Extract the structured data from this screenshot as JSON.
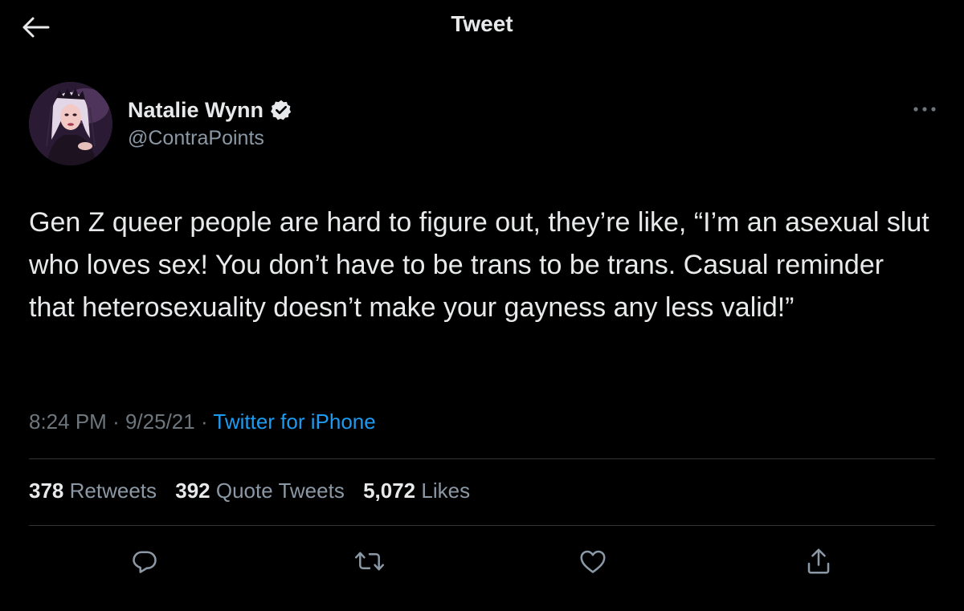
{
  "header": {
    "title": "Tweet",
    "back_icon": "arrow-left-icon"
  },
  "author": {
    "display_name": "Natalie Wynn",
    "handle": "@ContraPoints",
    "verified_icon": "verified-badge-icon",
    "more_icon": "more-horizontal-icon"
  },
  "tweet": {
    "text": "Gen Z queer people are hard to figure out, they’re like, “I’m an asexual slut who loves sex! You don’t have to be trans to be trans. Casual reminder that heterosexuality doesn’t make your gayness any less valid!”",
    "time": "8:24 PM",
    "date": "9/25/21",
    "separator": "·",
    "source": "Twitter for iPhone"
  },
  "stats": {
    "retweets_count": "378",
    "retweets_label": "Retweets",
    "quotes_count": "392",
    "quotes_label": "Quote Tweets",
    "likes_count": "5,072",
    "likes_label": "Likes"
  },
  "actions": {
    "reply_icon": "reply-icon",
    "retweet_icon": "retweet-icon",
    "like_icon": "heart-icon",
    "share_icon": "share-icon"
  },
  "colors": {
    "background": "#000000",
    "text_primary": "#e7e9ea",
    "text_secondary": "#8b98a5",
    "link": "#1d9bf0",
    "divider": "#2f3336"
  }
}
